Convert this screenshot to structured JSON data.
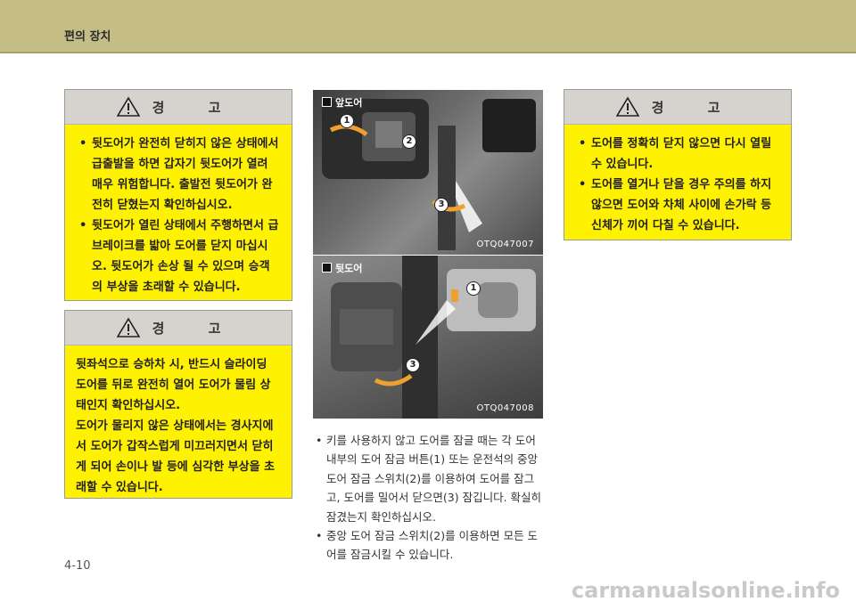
{
  "header": {
    "title": "편의 장치"
  },
  "warning_common": {
    "heading": "경 고"
  },
  "warning1": {
    "items": [
      "뒷도어가 완전히 닫히지 않은 상태에서 급출발을 하면 갑자기 뒷도어가 열려 매우 위험합니다. 출발전 뒷도어가 완전히 닫혔는지 확인하십시오.",
      "뒷도어가 열린 상태에서 주행하면서 급브레이크를 밟아 도어를 닫지 마십시오. 뒷도어가 손상 될 수 있으며 승객의 부상을 초래할 수 있습니다."
    ]
  },
  "warning2": {
    "paragraphs": [
      "뒷좌석으로 승하차 시, 반드시 슬라이딩 도어를 뒤로 완전히 열어 도어가 물림 상태인지 확인하십시오.",
      "도어가 물리지 않은 상태에서는 경사지에서 도어가 갑작스럽게 미끄러지면서 닫히게 되어 손이나 발 등에 심각한 부상을 초래할 수 있습니다."
    ]
  },
  "warning3": {
    "items": [
      "도어를 정확히 닫지 않으면 다시 열릴 수 있습니다.",
      "도어를 열거나 닫을 경우 주의를 하지 않으면 도어와 차체 사이에 손가락 등 신체가 끼어 다칠 수 있습니다."
    ]
  },
  "photo_front": {
    "label": "앞도어",
    "code": "OTQ047007",
    "callouts": [
      "1",
      "2",
      "3"
    ]
  },
  "photo_rear": {
    "label": "뒷도어",
    "code": "OTQ047008",
    "callouts": [
      "1",
      "3"
    ]
  },
  "body": {
    "items": [
      "키를 사용하지 않고 도어를 잠글 때는 각 도어 내부의 도어 잠금 버튼(1) 또는 운전석의 중앙 도어 잠금 스위치(2)를 이용하여 도어를 잠그고, 도어를 밀어서 닫으면(3) 잠깁니다. 확실히 잠겼는지 확인하십시오.",
      "중앙 도어 잠금 스위치(2)를 이용하면 모든 도어를 잠금시킬 수 있습니다."
    ]
  },
  "page_number": "4-10",
  "watermark": "carmanualsonline.info",
  "colors": {
    "warning_bg": "#fff200",
    "header_bg": "#c4bd86",
    "warning_head_bg": "#d6d3cf"
  }
}
